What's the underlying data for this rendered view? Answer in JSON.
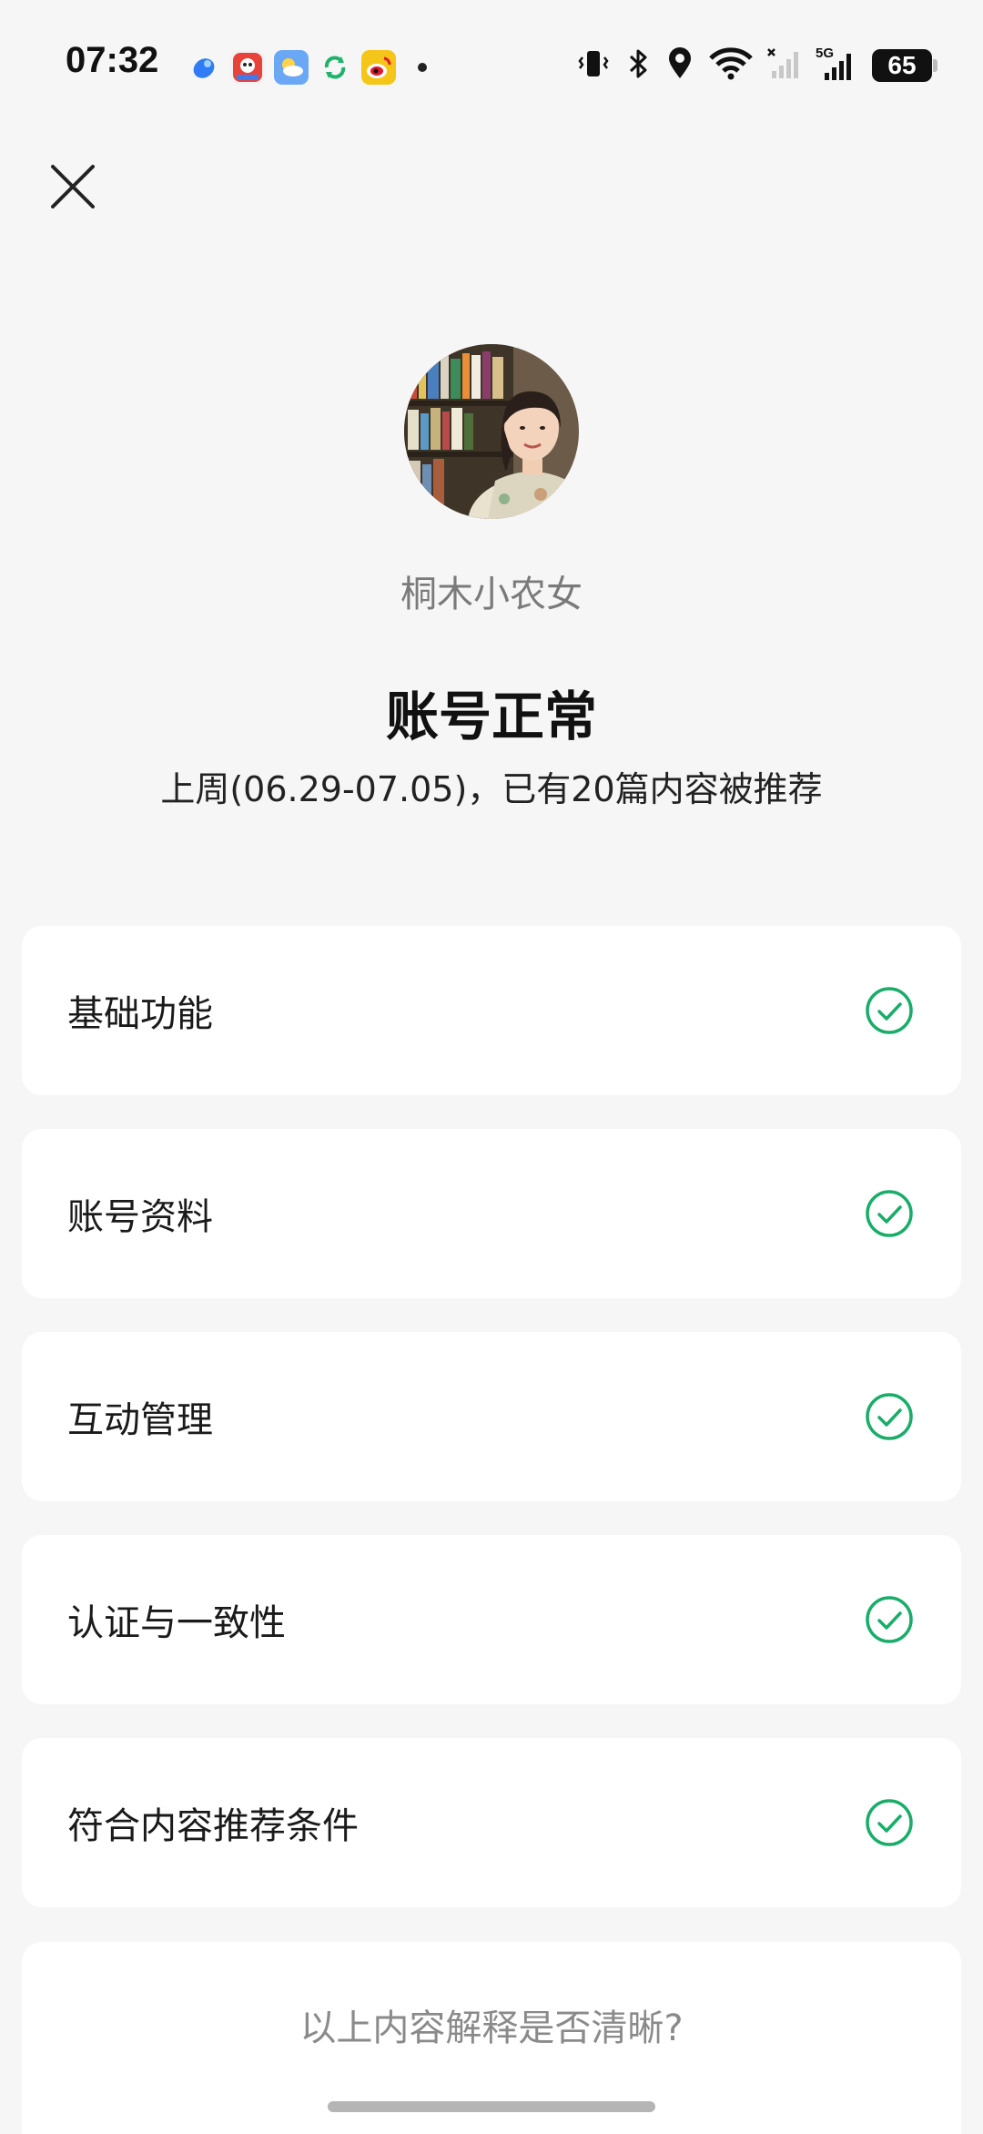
{
  "status_bar": {
    "time": "07:32",
    "battery": "65",
    "notification_icons": [
      "browser-app-icon",
      "game-app-icon",
      "weather-app-icon",
      "sync-app-icon",
      "weibo-app-icon"
    ],
    "system_icons": [
      "vibrate-icon",
      "bluetooth-icon",
      "location-icon",
      "wifi-icon",
      "signal-no-sim-icon",
      "signal-5g-icon",
      "battery-icon"
    ],
    "network_label": "5G"
  },
  "header": {
    "close_icon": "close-icon"
  },
  "profile": {
    "username": "桐木小农女",
    "status_title": "账号正常",
    "status_subtitle": "上周(06.29-07.05)，已有20篇内容被推荐"
  },
  "checks": [
    {
      "label": "基础功能",
      "status": "passed"
    },
    {
      "label": "账号资料",
      "status": "passed"
    },
    {
      "label": "互动管理",
      "status": "passed"
    },
    {
      "label": "认证与一致性",
      "status": "passed"
    },
    {
      "label": "符合内容推荐条件",
      "status": "passed"
    }
  ],
  "feedback": {
    "question": "以上内容解释是否清晰?"
  },
  "colors": {
    "background": "#f6f6f6",
    "card": "#ffffff",
    "check_green": "#1aad6a",
    "muted_text": "#8a8a8a"
  }
}
